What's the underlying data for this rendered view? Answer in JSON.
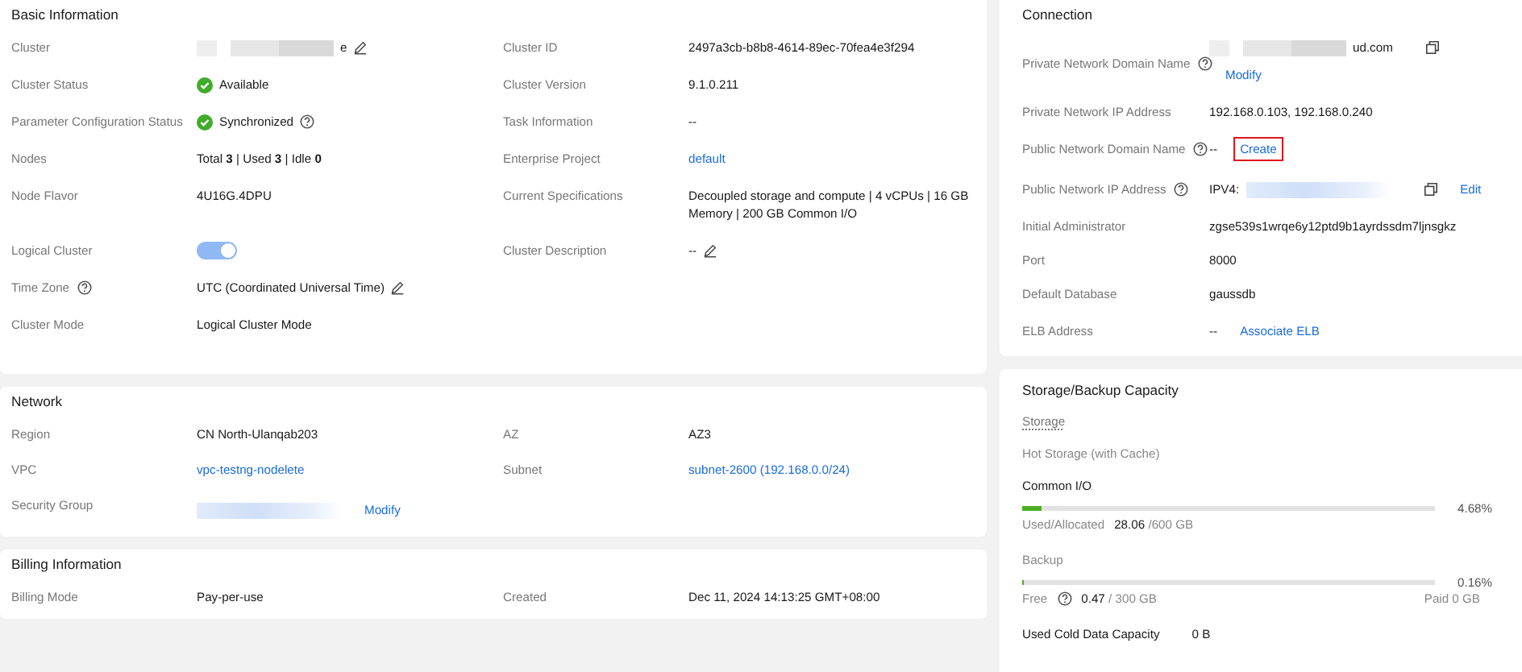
{
  "basic_information": {
    "title": "Basic Information",
    "rows": [
      [
        {
          "label": "Cluster",
          "kind": "redacted",
          "suffix": "e",
          "edit": true
        },
        {
          "label": "Cluster ID",
          "kind": "text",
          "value": "2497a3cb-b8b8-4614-89ec-70fea4e3f294"
        }
      ],
      [
        {
          "label": "Cluster Status",
          "kind": "status",
          "value": "Available"
        },
        {
          "label": "Cluster Version",
          "kind": "text",
          "value": "9.1.0.211"
        }
      ],
      [
        {
          "label": "Parameter Configuration Status",
          "kind": "status",
          "value": "Synchronized",
          "value_help": true
        },
        {
          "label": "Task Information",
          "kind": "text",
          "value": "--"
        }
      ],
      [
        {
          "label": "Nodes",
          "kind": "rich",
          "value": "Total **3** | Used **3** | Idle **0**"
        },
        {
          "label": "Enterprise Project",
          "kind": "link",
          "value": "default"
        }
      ],
      [
        {
          "label": "Node Flavor",
          "kind": "text",
          "value": "4U16G.4DPU"
        },
        {
          "label": "Current Specifications",
          "kind": "text",
          "value": "Decoupled storage and compute | 4 vCPUs | 16 GB Memory | 200 GB Common I/O"
        }
      ],
      [
        {
          "label": "Logical Cluster",
          "kind": "toggle",
          "on": true
        },
        {
          "label": "Cluster Description",
          "kind": "text",
          "value": "--",
          "edit": true
        }
      ],
      [
        {
          "label": "Time Zone",
          "label_help": true,
          "kind": "text",
          "value": "UTC (Coordinated Universal Time)",
          "edit": true
        }
      ],
      [
        {
          "label": "Cluster Mode",
          "kind": "text",
          "value": "Logical Cluster Mode"
        }
      ]
    ]
  },
  "network": {
    "title": "Network",
    "rows": [
      [
        {
          "label": "Region",
          "kind": "text",
          "value": "CN North-Ulanqab203"
        },
        {
          "label": "AZ",
          "kind": "text",
          "value": "AZ3"
        }
      ],
      [
        {
          "label": "VPC",
          "kind": "link",
          "value": "vpc-testng-nodelete"
        },
        {
          "label": "Subnet",
          "kind": "link",
          "value": "subnet-2600 (192.168.0.0/24)"
        }
      ],
      [
        {
          "label": "Security Group",
          "kind": "redacted",
          "linked": true,
          "action": "Modify"
        }
      ]
    ]
  },
  "billing_information": {
    "title": "Billing Information",
    "rows": [
      [
        {
          "label": "Billing Mode",
          "kind": "text",
          "value": "Pay-per-use"
        },
        {
          "label": "Created",
          "kind": "text",
          "value": "Dec 11, 2024 14:13:25 GMT+08:00"
        }
      ]
    ]
  },
  "connection": {
    "title": "Connection",
    "rows": [
      {
        "label": "Private Network Domain Name",
        "label_help": true,
        "kind": "redacted",
        "suffix": "ud.com",
        "copy": true,
        "action": "Modify",
        "action_highlighted": false
      },
      {
        "label": "Private Network IP Address",
        "kind": "text",
        "value": "192.168.0.103, 192.168.0.240"
      },
      {
        "label": "Public Network Domain Name",
        "label_help": true,
        "kind": "text",
        "value": "--",
        "action": "Create",
        "action_highlighted": true
      },
      {
        "label": "Public Network IP Address",
        "label_help": true,
        "kind": "redacted",
        "prefix": "IPV4:",
        "linked": true,
        "copy": true,
        "action": "Edit",
        "action_highlighted": false
      },
      {
        "label": "Initial Administrator",
        "kind": "text",
        "value": "zgse539s1wrqe6y12ptd9b1ayrdssdm7ljnsgkz"
      },
      {
        "label": "Port",
        "kind": "text",
        "value": "8000"
      },
      {
        "label": "Default Database",
        "kind": "text",
        "value": "gaussdb"
      },
      {
        "label": "ELB Address",
        "kind": "text",
        "value": "--",
        "action": "Associate ELB",
        "action_highlighted": false
      }
    ]
  },
  "storage_backup_capacity": {
    "title": "Storage/Backup Capacity",
    "section": "Storage",
    "tier": "Hot Storage (with Cache)",
    "common_io": {
      "title": "Common I/O",
      "level": 0.0468,
      "percent": "4.68%",
      "caption": "Used/Allocated",
      "used": "28.06",
      "total": "/600 GB"
    },
    "backup": {
      "title": "Backup",
      "level": 0.0016,
      "percent": "0.16%",
      "caption": "Free",
      "used": "0.47",
      "total": "/ 300 GB",
      "paid": "Paid 0 GB"
    },
    "cold": {
      "label": "Used Cold Data Capacity",
      "value": "0 B"
    }
  }
}
